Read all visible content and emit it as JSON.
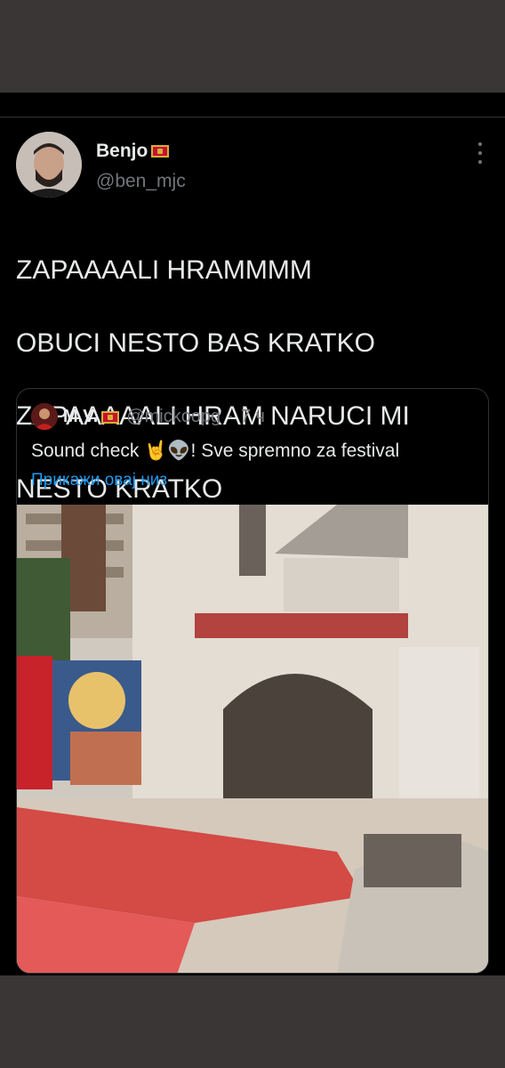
{
  "tweet": {
    "display_name": "Benjo",
    "handle": "@ben_mjc",
    "lines": [
      "ZAPAAAALI HRAMMMM",
      "OBUCI NESTO BAS KRATKO",
      "ZAPAAAAALI HRAM NARUCI MI",
      "NESTO KRATKO"
    ]
  },
  "quoted": {
    "display_name": "M.V.",
    "handle": "@mickoopg",
    "separator": "·",
    "time": "7 ч",
    "text": "Sound check 🤘👽! Sve spremno za festival",
    "show_thread": "Прикажи овај низ"
  },
  "icons": {
    "more": "more-vertical-icon",
    "flag": "montenegro-flag-icon"
  },
  "colors": {
    "background": "#000000",
    "outer": "#3a3636",
    "link": "#1d9bf0",
    "muted": "#71767b",
    "text": "#e7e9ea"
  }
}
